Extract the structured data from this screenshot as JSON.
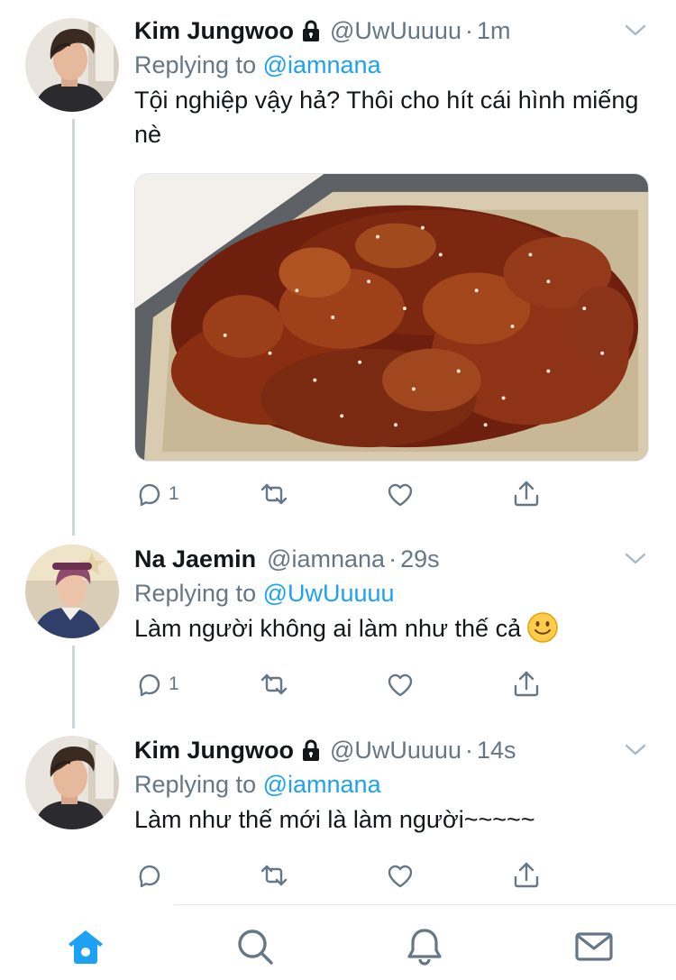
{
  "colors": {
    "accent": "#1da1f2",
    "secondary_text": "#657786",
    "primary_text": "#14171a",
    "thread_line": "#ccd6dd"
  },
  "tweets": [
    {
      "name": "Kim Jungwoo",
      "locked": true,
      "handle": "@UwUuuuu",
      "separator": "·",
      "time": "1m",
      "replying_prefix": "Replying to",
      "replying_to": "@iamnana",
      "text": "Tội nghiệp vậy hả? Thôi cho hít cái hình miếng nè",
      "has_media": true,
      "media_icon": "fried-chicken-photo",
      "reply_count": "1"
    },
    {
      "name": "Na Jaemin",
      "locked": false,
      "handle": "@iamnana",
      "separator": "·",
      "time": "29s",
      "replying_prefix": "Replying to",
      "replying_to": "@UwUuuuu",
      "text": "Làm người không ai làm như thế cả",
      "emoji": "slightly-smiling-face-icon",
      "reply_count": "1"
    },
    {
      "name": "Kim Jungwoo",
      "locked": true,
      "handle": "@UwUuuuu",
      "separator": "·",
      "time": "14s",
      "replying_prefix": "Replying to",
      "replying_to": "@iamnana",
      "text": "Làm như thế mới là làm người~~~~~",
      "reply_count": ""
    }
  ],
  "tabbar": {
    "items": [
      "home-icon",
      "search-icon",
      "notifications-icon",
      "messages-icon"
    ],
    "active": "home-icon"
  }
}
